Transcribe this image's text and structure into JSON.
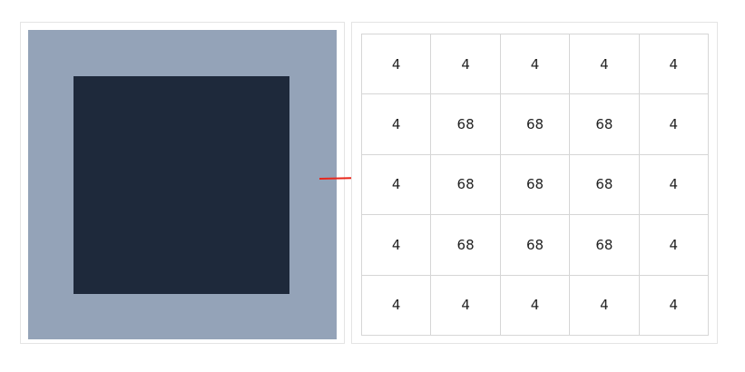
{
  "colors": {
    "outer_region": "#94a3b8",
    "inner_region": "#1e293b",
    "arrow": "#e8271c",
    "grid_line": "#d6d6d6",
    "cell_text": "#222222"
  },
  "matrix": [
    [
      "4",
      "4",
      "4",
      "4",
      "4"
    ],
    [
      "4",
      "68",
      "68",
      "68",
      "4"
    ],
    [
      "4",
      "68",
      "68",
      "68",
      "4"
    ],
    [
      "4",
      "68",
      "68",
      "68",
      "4"
    ],
    [
      "4",
      "4",
      "4",
      "4",
      "4"
    ]
  ]
}
